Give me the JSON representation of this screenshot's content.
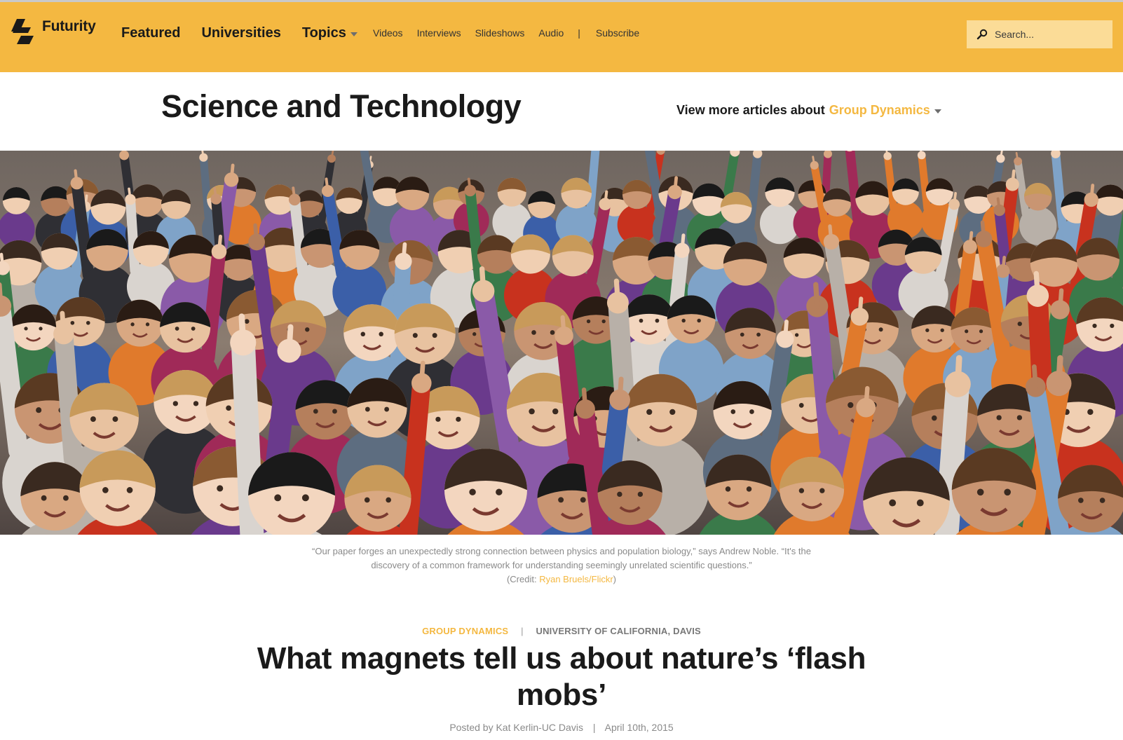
{
  "header": {
    "logo_text": "Futurity",
    "nav_main": [
      {
        "label": "Featured"
      },
      {
        "label": "Universities"
      },
      {
        "label": "Topics"
      }
    ],
    "nav_sub": [
      {
        "label": "Videos"
      },
      {
        "label": "Interviews"
      },
      {
        "label": "Slideshows"
      },
      {
        "label": "Audio"
      }
    ],
    "nav_separator": "|",
    "subscribe_label": "Subscribe",
    "search_placeholder": "Search..."
  },
  "section": {
    "title": "Science and Technology",
    "more_prefix": "View more articles about",
    "more_topic": "Group Dynamics"
  },
  "hero": {
    "caption_quote": "“Our paper forges an unexpectedly strong connection between physics and population biology,” says Andrew Noble. “It's the discovery of a common framework for understanding seemingly unrelated scientific questions.”",
    "credit_prefix": "(Credit: ",
    "credit_link": "Ryan Bruels/Flickr",
    "credit_suffix": ")"
  },
  "article": {
    "category": "GROUP DYNAMICS",
    "meta_separator": "|",
    "university": "UNIVERSITY OF CALIFORNIA, DAVIS",
    "headline": "What magnets tell us about nature’s ‘flash mobs’",
    "byline": "Posted by Kat Kerlin-UC Davis",
    "byline_separator": "|",
    "date": "April 10th, 2015"
  },
  "colors": {
    "brand_yellow": "#f4b841",
    "search_bg": "#fbdc97",
    "text_dark": "#1a1a1a",
    "text_muted": "#8a8a8a"
  }
}
